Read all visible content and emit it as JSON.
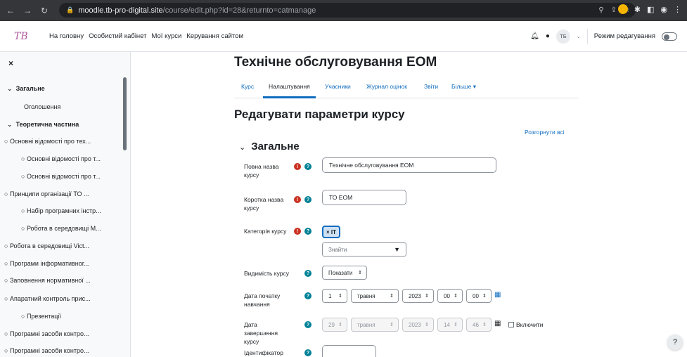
{
  "browser": {
    "url_host": "moodle.tb-pro-digital.site",
    "url_path": "/course/edit.php?id=28&returnto=catmanage"
  },
  "navbar": {
    "logo": "TB",
    "links": [
      "На головну",
      "Особистий кабінет",
      "Мої курси",
      "Керування сайтом"
    ],
    "avatar_initials": "ТБ",
    "edit_mode_label": "Режим редагування"
  },
  "drawer": {
    "close": "×",
    "items": [
      {
        "label": "Загальне",
        "kind": "section"
      },
      {
        "label": "Оголошення",
        "kind": "link"
      },
      {
        "label": "Теоретична частина",
        "kind": "section"
      },
      {
        "label": "Основні відомості про тех...",
        "kind": "activity"
      },
      {
        "label": "Основні відомості про т...",
        "kind": "activity"
      },
      {
        "label": "Основні відомості про т...",
        "kind": "activity"
      },
      {
        "label": "Принципи організації ТО ...",
        "kind": "activity"
      },
      {
        "label": "Набір програмних інстр...",
        "kind": "activity"
      },
      {
        "label": "Робота в середовищі М...",
        "kind": "activity"
      },
      {
        "label": "Робота в середовищі Vict...",
        "kind": "activity"
      },
      {
        "label": "Програми інформативног...",
        "kind": "activity"
      },
      {
        "label": "Заповнення нормативної ...",
        "kind": "activity"
      },
      {
        "label": "Апаратний контроль прис...",
        "kind": "activity"
      },
      {
        "label": "Презентації",
        "kind": "activity"
      },
      {
        "label": "Програмні засоби контро...",
        "kind": "activity"
      },
      {
        "label": "Програмні засоби контро...",
        "kind": "activity"
      }
    ]
  },
  "course_title": "Технічне обслуговування ЕОМ",
  "secondary_nav": [
    "Курс",
    "Налаштування",
    "Учасники",
    "Журнал оцінок",
    "Звіти",
    "Більше ▾"
  ],
  "page_heading": "Редагувати параметри курсу",
  "expand_all": "Розгорнути всі",
  "section_title": "Загальне",
  "form": {
    "fullname_label": "Повна назва курсу",
    "fullname_value": "Технічне обслуговування ЕОМ",
    "shortname_label": "Коротка назва курсу",
    "shortname_value": "ТО ЕОМ",
    "category_label": "Категорія курсу",
    "category_tag": "× IT",
    "category_search": "Знайти",
    "visibility_label": "Видимість курсу",
    "visibility_value": "Показати",
    "startdate_label": "Дата початку навчання",
    "startdate": {
      "day": "1",
      "month": "травня",
      "year": "2023",
      "hour": "00",
      "minute": "00"
    },
    "enddate_label": "Дата завершення курсу",
    "enddate": {
      "day": "29",
      "month": "травня",
      "year": "2023",
      "hour": "14",
      "minute": "46"
    },
    "enable_label": "Включити",
    "idnumber_label": "Ідентифікатор"
  },
  "colors": {
    "link": "#0f6cbf",
    "required": "#ca3120",
    "help": "#008196"
  }
}
